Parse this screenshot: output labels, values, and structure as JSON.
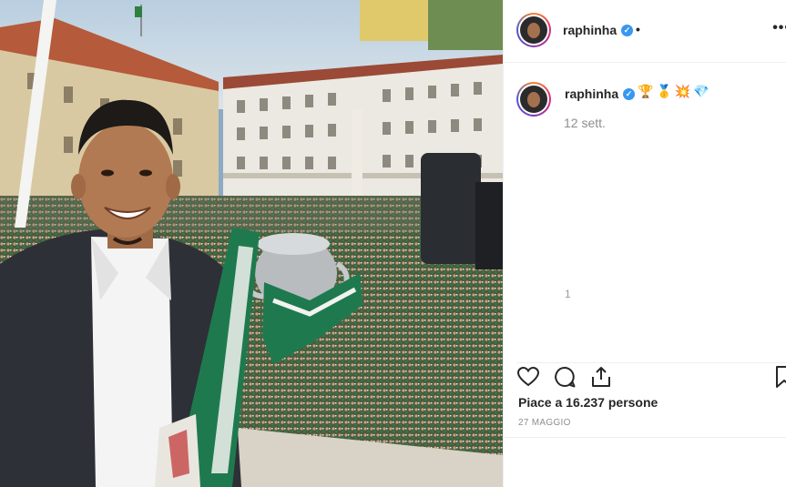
{
  "post": {
    "username": "raphinha",
    "verified_icon": "verified-badge-icon",
    "separator": "•",
    "more_icon": "more-options-icon",
    "caption_emojis": [
      "🏆",
      "🥇",
      "💥",
      "💎"
    ],
    "comment_time": "12 sett.",
    "stray_text": "1",
    "likes_text": "Piace a 16.237 persone",
    "date": "27 MAGGIO",
    "icons": {
      "like": "heart-icon",
      "comment": "comment-icon",
      "share": "share-icon",
      "save": "bookmark-icon"
    },
    "colors": {
      "scarf_green": "#1e7a4e",
      "verified_blue": "#3897f0",
      "text_gray": "#8e8e8e"
    }
  }
}
